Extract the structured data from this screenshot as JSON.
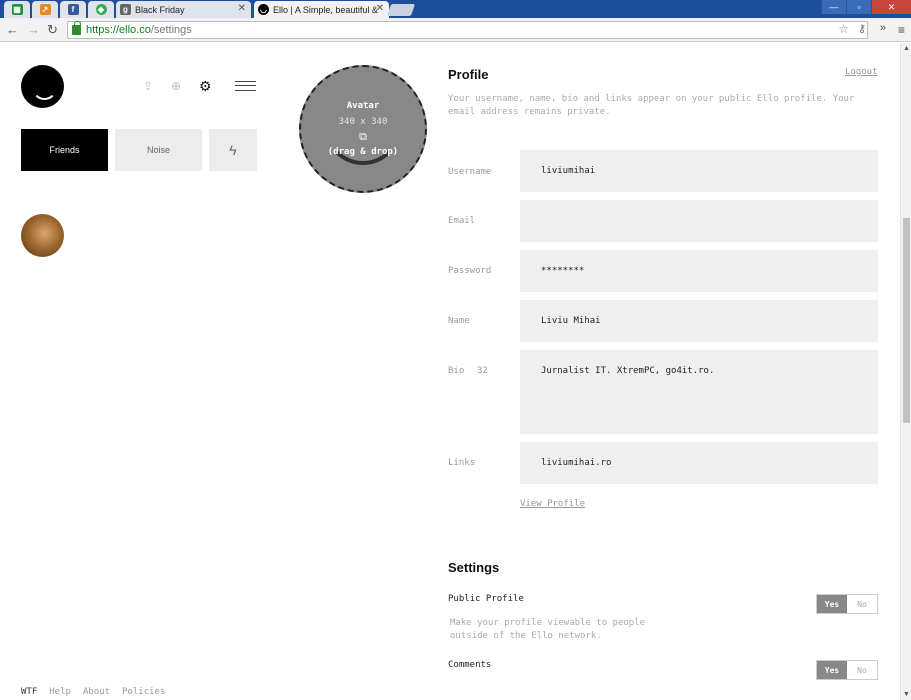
{
  "browser": {
    "tabs": [
      {
        "title": "",
        "color": "#1f8f3c"
      },
      {
        "title": "",
        "color": "#e38b2c"
      },
      {
        "title": "",
        "color": "#3b5998"
      },
      {
        "title": "",
        "color": "#3aa757"
      },
      {
        "title": "Black Friday",
        "color": "#555555"
      },
      {
        "title": "Ello | A Simple, beautiful &",
        "color": "#000000"
      }
    ],
    "url_host": "https://ello.co",
    "url_path": "/settings"
  },
  "sidebar": {
    "tabs": {
      "friends": "Friends",
      "noise": "Noise"
    }
  },
  "avatar_drop": {
    "title": "Avatar",
    "size": "340 x 340",
    "hint": "(drag & drop)"
  },
  "profile": {
    "title": "Profile",
    "logout": "Logout",
    "description_line1": "Your username, name, bio and links appear on your public Ello profile. Your",
    "description_line2": "email address remains private.",
    "fields": {
      "username": {
        "label": "Username",
        "value": "liviumihai"
      },
      "email": {
        "label": "Email",
        "value": ""
      },
      "password": {
        "label": "Password",
        "value": "********"
      },
      "name": {
        "label": "Name",
        "value": "Liviu Mihai"
      },
      "bio": {
        "label": "Bio",
        "count": "32",
        "value": "Jurnalist IT. XtremPC, go4it.ro."
      },
      "links": {
        "label": "Links",
        "value": "liviumihai.ro"
      }
    },
    "view_profile": "View Profile"
  },
  "settings": {
    "title": "Settings",
    "public_profile": {
      "label": "Public Profile",
      "desc_line1": "Make your profile viewable to people",
      "desc_line2": "outside of the Ello network.",
      "yes": "Yes",
      "no": "No",
      "selected": "Yes"
    },
    "comments": {
      "label": "Comments",
      "yes": "Yes",
      "no": "No",
      "selected": "Yes"
    }
  },
  "footer": {
    "links": [
      "WTF",
      "Help",
      "About",
      "Policies"
    ]
  }
}
